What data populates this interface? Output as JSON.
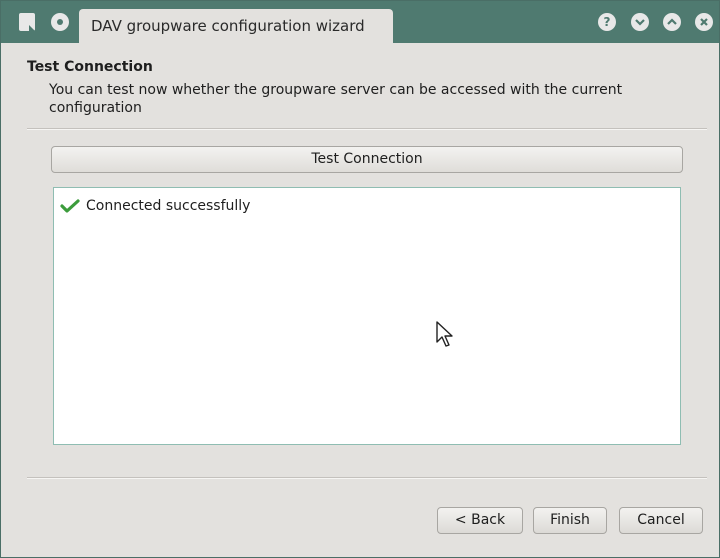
{
  "window": {
    "title": "DAV groupware configuration wizard",
    "icons": {
      "menu": "window-menu-icon",
      "on_all_desktops": "on-all-desktops-icon",
      "help": "help-icon",
      "minimize": "minimize-icon",
      "maximize": "maximize-icon",
      "close": "close-icon"
    },
    "help_glyph": "?"
  },
  "header": {
    "title": "Test Connection",
    "subtitle": "You can test now whether the groupware server can be accessed with the current configuration"
  },
  "test_button": {
    "label": "Test Connection"
  },
  "result": {
    "status_text": "Connected successfully",
    "status_icon": "check-icon",
    "status_color": "#3c9c3c"
  },
  "footer": {
    "back_label": "< Back",
    "finish_label": "Finish",
    "cancel_label": "Cancel"
  },
  "colors": {
    "titlebar": "#4f7a70",
    "window_bg": "#e3e1de",
    "result_border": "#8fbdb2"
  }
}
